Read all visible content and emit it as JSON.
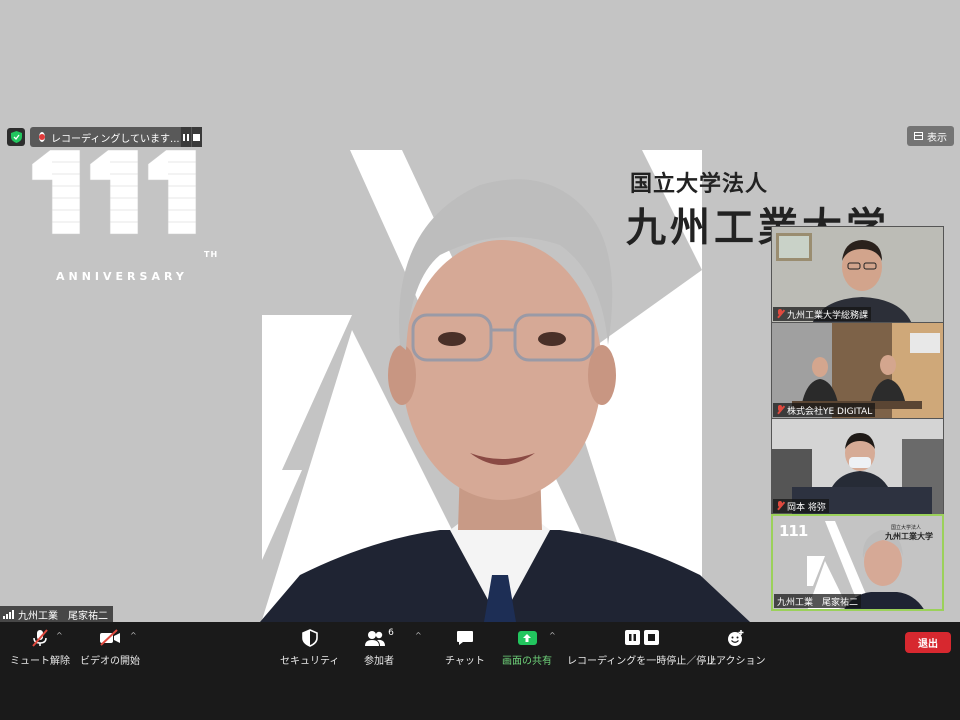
{
  "recording": {
    "text": "レコーディングしています..."
  },
  "view_button": {
    "label": "表示"
  },
  "background": {
    "logo_number": "111",
    "logo_suffix": "TH",
    "logo_subtitle": "ANNIVERSARY",
    "university_corp": "国立大学法人",
    "university_name": "九州工業大学"
  },
  "main_video": {
    "participant_name": "九州工業　尾家祐二"
  },
  "gallery": [
    {
      "name": "九州工業大学総務課",
      "muted": true
    },
    {
      "name": "株式会社YE DIGITAL",
      "muted": true
    },
    {
      "name": "岡本 将弥",
      "muted": true
    },
    {
      "name": "九州工業　尾家祐二",
      "muted": false,
      "thumb_logo": "111",
      "thumb_corp": "国立大学法人",
      "thumb_univ": "九州工業大学"
    }
  ],
  "toolbar": {
    "unmute_label": "ミュート解除",
    "video_label": "ビデオの開始",
    "security_label": "セキュリティ",
    "participants_label": "参加者",
    "participants_count": "6",
    "chat_label": "チャット",
    "share_label": "画面の共有",
    "record_label": "レコーディングを一時停止／停止",
    "reaction_label": "リアクション",
    "leave_label": "退出"
  },
  "colors": {
    "stage_bg": "#c4c4c4",
    "toolbar_bg": "#1a1a1a",
    "leave_red": "#d7282f",
    "share_green": "#22c55e",
    "active_speaker_border": "#9bd15a",
    "muted_red": "#e04a3f"
  }
}
